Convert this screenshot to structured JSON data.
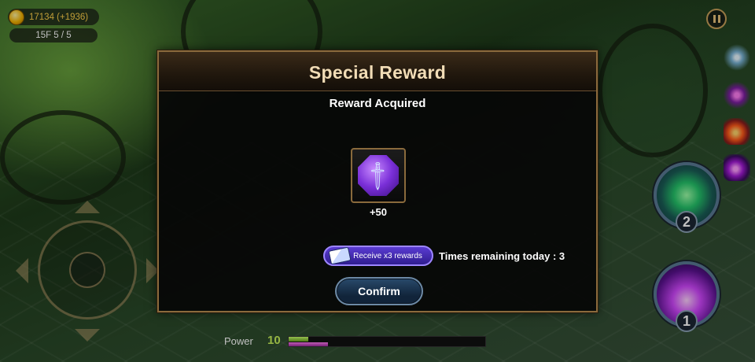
{
  "hud": {
    "gold": "17134 (+1936)",
    "floor": "15F 5 / 5",
    "pause_icon": "pause-icon"
  },
  "buffs": [
    "spirit-buff-icon",
    "void-orb-buff-icon",
    "fire-buff-icon",
    "shadow-orb-buff-icon"
  ],
  "skills": [
    {
      "icon": "dash-skill-icon",
      "count": "2"
    },
    {
      "icon": "burst-skill-icon",
      "count": "1"
    }
  ],
  "power": {
    "label": "Power",
    "value": "10",
    "bar_primary_fraction": 0.1,
    "bar_secondary_fraction": 0.2,
    "colors": {
      "primary": "#c9ff6b",
      "secondary": "#ff7bf0"
    }
  },
  "modal": {
    "title": "Special Reward",
    "subtitle": "Reward Acquired",
    "item": {
      "icon": "sword-gem-icon",
      "quantity": "+50"
    },
    "receive_button": "Receive x3 rewards",
    "times_remaining": "Times remaining today : 3",
    "confirm_button": "Confirm"
  }
}
